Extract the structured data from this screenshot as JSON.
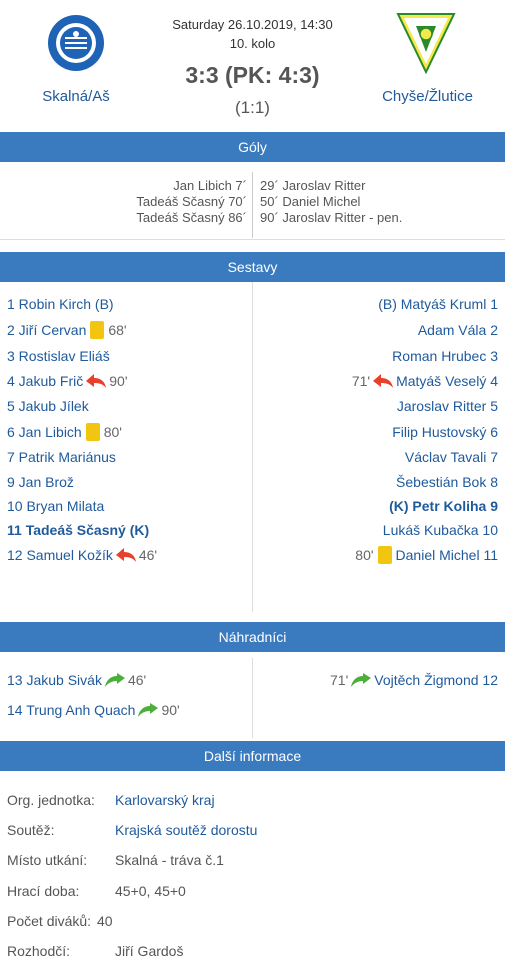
{
  "match": {
    "date": "Saturday 26.10.2019, 14:30",
    "round": "10. kolo",
    "score": "3:3 (PK: 4:3)",
    "halftime": "(1:1)",
    "home": {
      "name": "Skalná/Aš",
      "logo_text": "TJ JISKRA AŠ FOTBAL"
    },
    "away": {
      "name": "Chyše/Žlutice"
    }
  },
  "sections": {
    "goals": "Góly",
    "lineups": "Sestavy",
    "subs": "Náhradníci",
    "info": "Další informace"
  },
  "goals": {
    "home": [
      "Jan Libich 7´",
      "Tadeáš Sčasný 70´",
      "Tadeáš Sčasný 86´"
    ],
    "away": [
      "29´ Jaroslav Ritter",
      "50´ Daniel Michel",
      "90´ Jaroslav Ritter - pen."
    ]
  },
  "lineups": {
    "home": [
      {
        "name": "1 Robin Kirch (B)"
      },
      {
        "name": "2 Jiří Cervan",
        "card_minute": "68'"
      },
      {
        "name": "3 Rostislav Eliáš"
      },
      {
        "name": "4 Jakub Frič",
        "sub_out_minute": "90'"
      },
      {
        "name": "5 Jakub Jílek"
      },
      {
        "name": "6 Jan Libich",
        "card_minute": "80'"
      },
      {
        "name": "7 Patrik Mariánus"
      },
      {
        "name": "9 Jan Brož"
      },
      {
        "name": "10 Bryan Milata"
      },
      {
        "name": "11 Tadeáš Sčasný (K)",
        "bold": true
      },
      {
        "name": "12 Samuel Kožík",
        "sub_out_minute": "46'"
      }
    ],
    "away": [
      {
        "name": "(B) Matyáš Kruml 1"
      },
      {
        "name": "Adam Vála 2"
      },
      {
        "name": "Roman Hrubec 3"
      },
      {
        "name": "Matyáš Veselý 4",
        "sub_out_minute": "71'"
      },
      {
        "name": "Jaroslav Ritter 5"
      },
      {
        "name": "Filip Hustovský 6"
      },
      {
        "name": "Václav Tavali 7"
      },
      {
        "name": "Šebestián Bok 8"
      },
      {
        "name": "(K) Petr Koliha 9",
        "bold": true
      },
      {
        "name": "Lukáš Kubačka 10"
      },
      {
        "name": "Daniel Michel 11",
        "card_minute": "80'"
      }
    ]
  },
  "subs": {
    "home": [
      {
        "name": "13 Jakub Sivák",
        "sub_in_minute": "46'"
      },
      {
        "name": "14 Trung Anh Quach",
        "sub_in_minute": "90'"
      }
    ],
    "away": [
      {
        "name": "Vojtěch Žigmond 12",
        "sub_in_minute": "71'"
      }
    ]
  },
  "info": [
    {
      "label": "Org. jednotka:",
      "value": "Karlovarský kraj",
      "link": true
    },
    {
      "label": "Soutěž:",
      "value": "Krajská soutěž dorostu",
      "link": true
    },
    {
      "label": "Místo utkání:",
      "value": "Skalná - tráva č.1",
      "link": false
    },
    {
      "label": "Hrací doba:",
      "value": "45+0, 45+0",
      "link": false
    },
    {
      "label": "Počet diváků:",
      "value": "40",
      "link": false
    },
    {
      "label": "Rozhodčí:",
      "value": "Jiří Gardoš",
      "link": false
    }
  ],
  "colors": {
    "section_bar": "#3a7bbf",
    "link": "#1f5a9c",
    "card_yellow": "#f2c511",
    "arrow_out": "#e8402a",
    "arrow_in": "#4caf3a"
  },
  "icons": {
    "card": "yellow-card-icon",
    "sub_out": "substitution-out-arrow-icon",
    "sub_in": "substitution-in-arrow-icon"
  }
}
